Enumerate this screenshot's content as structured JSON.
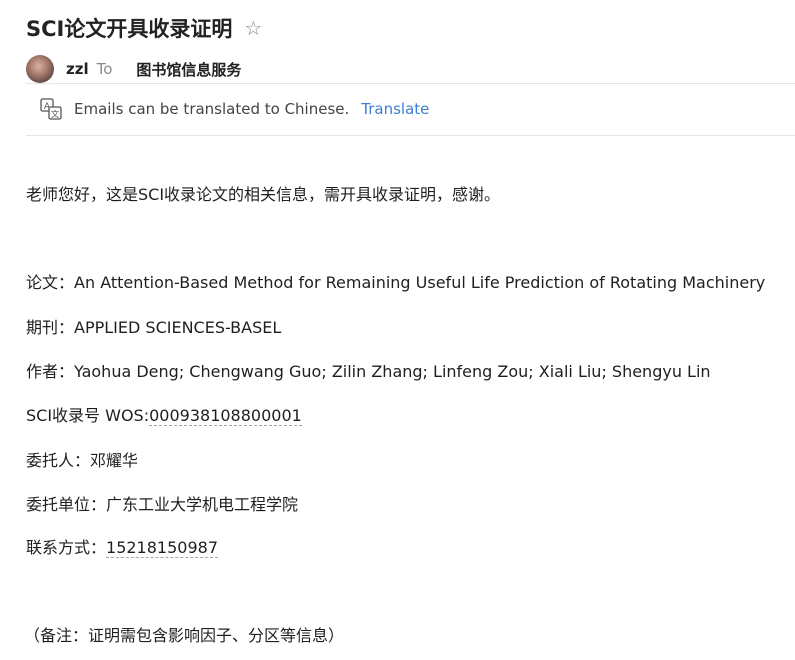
{
  "email": {
    "subject": "SCI论文开具收录证明",
    "sender": "zzl",
    "to_label": "To",
    "recipient": "图书馆信息服务"
  },
  "translate_bar": {
    "message": "Emails can be translated to Chinese.",
    "link": "Translate",
    "icon": "translate-icon"
  },
  "body": {
    "greeting": "老师您好，这是SCI收录论文的相关信息，需开具收录证明，感谢。",
    "paper_label": "论文：",
    "paper_value": "An Attention-Based Method for Remaining Useful Life Prediction of Rotating Machinery",
    "journal_label": "期刊：",
    "journal_value": "APPLIED SCIENCES-BASEL",
    "authors_label": "作者：",
    "authors_value": "Yaohua Deng; Chengwang Guo; Zilin Zhang; Linfeng Zou; Xiali Liu; Shengyu Lin",
    "sci_label": "SCI收录号 WOS:",
    "sci_value": "000938108800001",
    "client_label": "委托人：",
    "client_value": "邓耀华",
    "unit_label": "委托单位：",
    "unit_value": "广东工业大学机电工程学院",
    "contact_label": "联系方式：",
    "contact_value": "15218150987",
    "note": "（备注：证明需包含影响因子、分区等信息）"
  },
  "colors": {
    "link": "#3b7fd6",
    "muted": "#8a8a8a",
    "text": "#1f1f1f"
  }
}
